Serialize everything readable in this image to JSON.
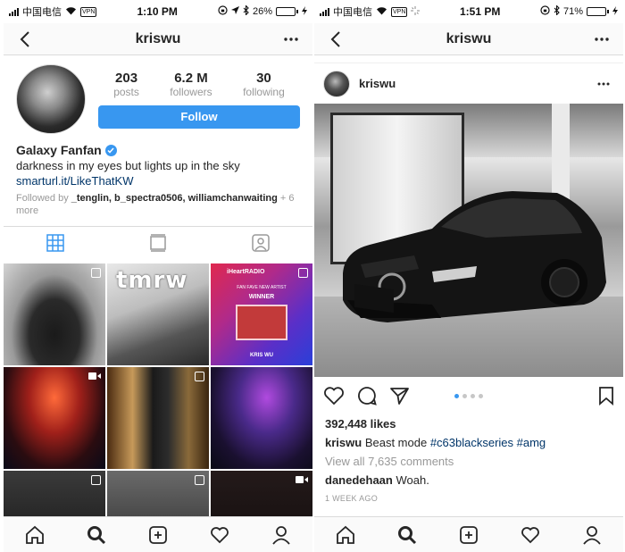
{
  "left": {
    "status": {
      "carrier": "中国电信",
      "vpn": "VPN",
      "time": "1:10 PM",
      "battery": "26%",
      "battery_level": 0.26
    },
    "nav": {
      "title": "kriswu"
    },
    "profile": {
      "posts_count": "203",
      "posts_label": "posts",
      "followers_count": "6.2 M",
      "followers_label": "followers",
      "following_count": "30",
      "following_label": "following",
      "follow_label": "Follow",
      "name": "Galaxy Fanfan",
      "bio": "darkness in my eyes but lights up in the sky",
      "link": "smarturl.it/LikeThatKW",
      "followed_by_prefix": "Followed by",
      "followed_by_names": "_tenglin, b_spectra0506, williamchanwaiting",
      "followed_by_more": "+ 6 more"
    },
    "grid": {
      "tmrw": "tmrw",
      "iheart": "iHeartRADIO",
      "fan_fave": "FAN FAVE NEW ARTIST",
      "winner": "WINNER",
      "artist": "KRIS WU"
    }
  },
  "right": {
    "status": {
      "carrier": "中国电信",
      "vpn": "VPN",
      "time": "1:51 PM",
      "battery": "71%",
      "battery_level": 0.71
    },
    "nav": {
      "title": "kriswu"
    },
    "post": {
      "username": "kriswu",
      "likes": "392,448 likes",
      "caption_user": "kriswu",
      "caption_text": "Beast mode",
      "hashtags": "#c63blackseries #amg",
      "view_all": "View all 7,635 comments",
      "comment_user": "danedehaan",
      "comment_text": "Woah.",
      "time": "1 WEEK AGO",
      "carousel_count": 4,
      "carousel_active": 1
    }
  },
  "colors": {
    "accent": "#3897f0",
    "link": "#003569",
    "muted": "#999999",
    "border": "#dbdbdb"
  }
}
